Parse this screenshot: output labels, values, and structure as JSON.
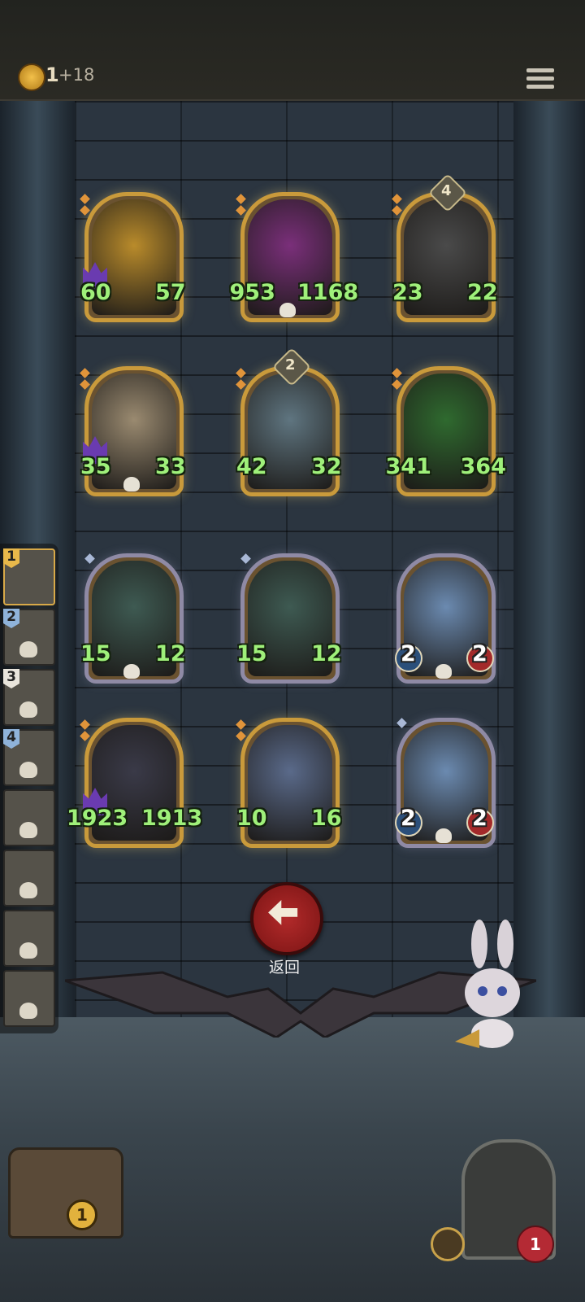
{
  "header": {
    "coins": "1",
    "coin_income": "+18",
    "coin_icon": "crown-coin-icon",
    "menu_icon": "menu-icon"
  },
  "board": {
    "cards": [
      {
        "name": "flame-serpent-card",
        "frame": "gold",
        "attack": "60",
        "health": "57",
        "stat_style": "green",
        "tribe": true,
        "skull": false,
        "level": ""
      },
      {
        "name": "red-dragon-card",
        "frame": "gold",
        "attack": "953",
        "health": "1168",
        "stat_style": "green",
        "tribe": false,
        "skull": true,
        "level": ""
      },
      {
        "name": "armored-knight-card",
        "frame": "gold",
        "attack": "23",
        "health": "22",
        "stat_style": "green",
        "tribe": false,
        "skull": false,
        "level": "4"
      },
      {
        "name": "bone-dragon-card",
        "frame": "gold",
        "attack": "35",
        "health": "33",
        "stat_style": "green",
        "tribe": true,
        "skull": true,
        "level": ""
      },
      {
        "name": "horned-beast-card",
        "frame": "gold",
        "attack": "42",
        "health": "32",
        "stat_style": "green",
        "tribe": false,
        "skull": false,
        "level": "2"
      },
      {
        "name": "forest-dryad-card",
        "frame": "gold",
        "attack": "341",
        "health": "364",
        "stat_style": "green",
        "tribe": false,
        "skull": false,
        "level": ""
      },
      {
        "name": "oni-elf-card-1",
        "frame": "silver",
        "attack": "15",
        "health": "12",
        "stat_style": "green",
        "tribe": false,
        "skull": true,
        "level": ""
      },
      {
        "name": "oni-elf-card-2",
        "frame": "silver",
        "attack": "15",
        "health": "12",
        "stat_style": "green",
        "tribe": false,
        "skull": false,
        "level": ""
      },
      {
        "name": "pinocchio-card-1",
        "frame": "silver",
        "attack": "2",
        "health": "2",
        "stat_style": "white",
        "tribe": false,
        "skull": true,
        "level": ""
      },
      {
        "name": "top-hat-gentleman-card",
        "frame": "gold",
        "attack": "1923",
        "health": "1913",
        "stat_style": "green",
        "tribe": true,
        "skull": false,
        "level": ""
      },
      {
        "name": "sea-elf-card",
        "frame": "gold",
        "attack": "10",
        "health": "16",
        "stat_style": "green",
        "tribe": false,
        "skull": false,
        "level": ""
      },
      {
        "name": "pinocchio-card-2",
        "frame": "silver",
        "attack": "2",
        "health": "2",
        "stat_style": "white",
        "tribe": false,
        "skull": true,
        "level": ""
      }
    ]
  },
  "queue": {
    "slots": [
      {
        "label": "1",
        "style": "gold",
        "skull": false,
        "active": true
      },
      {
        "label": "2",
        "style": "blue",
        "skull": true,
        "active": false
      },
      {
        "label": "3",
        "style": "white",
        "skull": true,
        "active": false
      },
      {
        "label": "4",
        "style": "blue",
        "skull": true,
        "active": false
      },
      {
        "label": "",
        "style": "",
        "skull": true,
        "active": false
      },
      {
        "label": "",
        "style": "",
        "skull": true,
        "active": false
      },
      {
        "label": "",
        "style": "",
        "skull": true,
        "active": false
      },
      {
        "label": "",
        "style": "",
        "skull": true,
        "active": false
      }
    ]
  },
  "controls": {
    "back_label": "返回",
    "back_icon": "arrow-left-icon"
  },
  "footer": {
    "chest_count": "1",
    "hero_health": "1",
    "chest_icon": "treasure-chest-icon",
    "hero_icon": "hooded-hero-icon"
  },
  "colors": {
    "gold_frame": "#c99a3b",
    "silver_frame": "#8f8aa5",
    "stat_green": "#9ff07a",
    "back_red": "#b22a2a"
  }
}
